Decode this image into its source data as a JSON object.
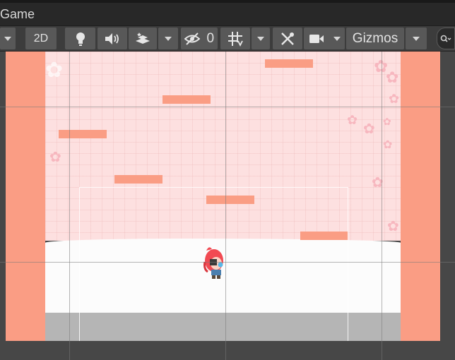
{
  "window": {
    "tab_title": "Game"
  },
  "toolbar": {
    "mode_2d_label": "2D",
    "hidden_count": "0",
    "gizmos_label": "Gizmos"
  },
  "colors": {
    "platform": "#fa9d84",
    "sky": "#fde0e0",
    "snow": "#fcfcfc",
    "ground": "#b5b5b5",
    "toolbar_button": "#585858"
  }
}
